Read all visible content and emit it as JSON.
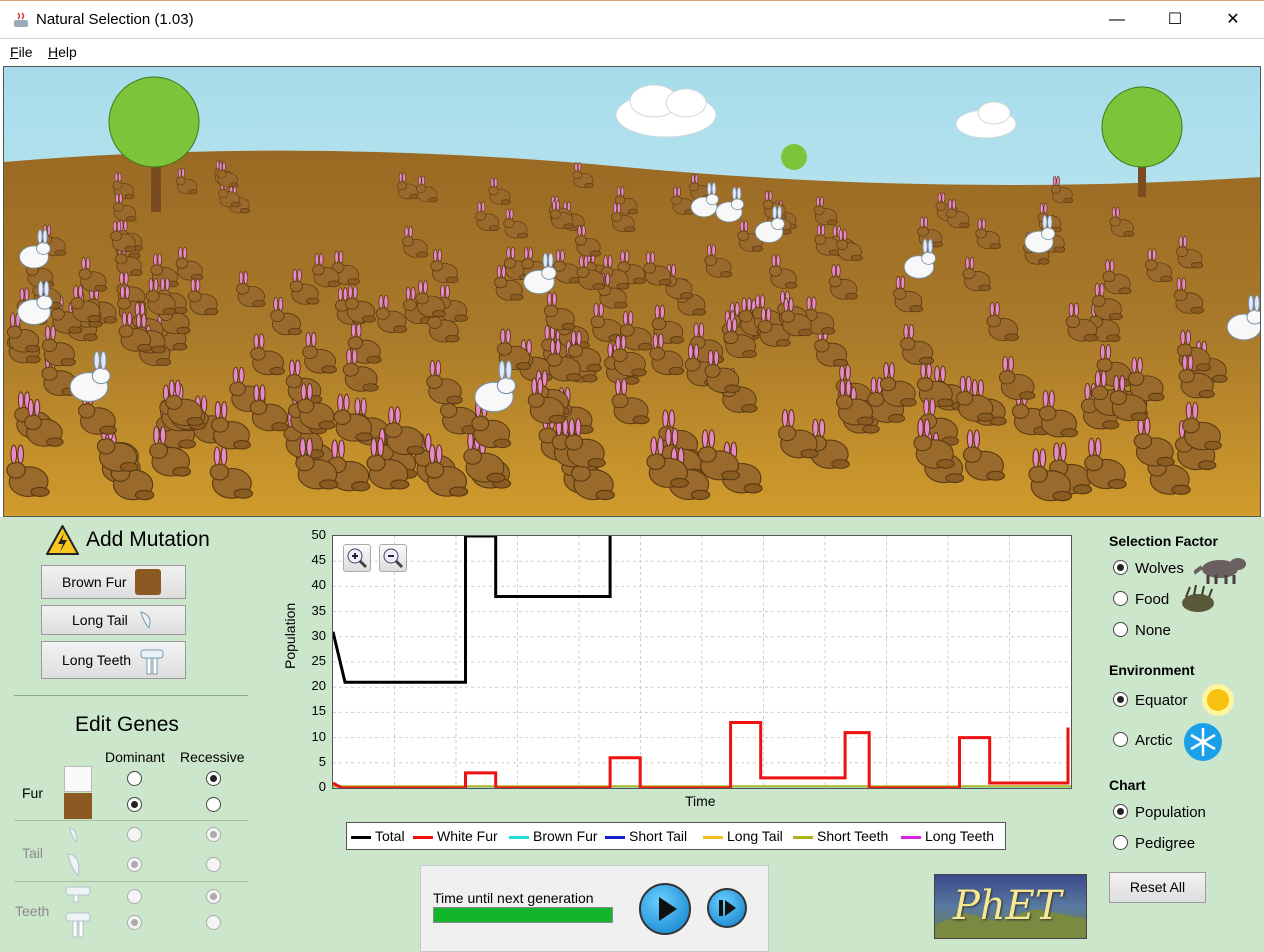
{
  "window": {
    "title": "Natural Selection (1.03)",
    "minimize_glyph": "—",
    "maximize_glyph": "☐",
    "close_glyph": "✕"
  },
  "menu": [
    {
      "key": "F",
      "rest": "ile"
    },
    {
      "key": "H",
      "rest": "elp"
    }
  ],
  "mutation": {
    "title": "Add Mutation",
    "buttons": [
      "Brown Fur",
      "Long Tail",
      "Long Teeth"
    ]
  },
  "genes": {
    "title": "Edit Genes",
    "col_dominant": "Dominant",
    "col_recessive": "Recessive",
    "rows": [
      {
        "label": "Fur",
        "dominant_selected": "bottom",
        "recessive_selected": "top",
        "enabled": true
      },
      {
        "label": "Tail",
        "enabled": false
      },
      {
        "label": "Teeth",
        "enabled": false
      }
    ]
  },
  "chart_data": {
    "type": "line",
    "xlabel": "Time",
    "ylabel": "Population",
    "ylim": [
      0,
      50
    ],
    "yticks": [
      "0",
      "5",
      "10",
      "15",
      "20",
      "25",
      "30",
      "35",
      "40",
      "45",
      "50"
    ],
    "grid": true,
    "series": [
      {
        "name": "Total",
        "color": "#000000"
      },
      {
        "name": "White Fur",
        "color": "#ee1111"
      },
      {
        "name": "Brown Fur",
        "color": "#22dddd"
      },
      {
        "name": "Short Tail",
        "color": "#1122cc"
      },
      {
        "name": "Long Tail",
        "color": "#f0c020"
      },
      {
        "name": "Short Teeth",
        "color": "#b0b020"
      },
      {
        "name": "Long Teeth",
        "color": "#e020e0"
      }
    ],
    "total_steps": [
      [
        0,
        31
      ],
      [
        0.02,
        21
      ],
      [
        0.22,
        21
      ],
      [
        0.22,
        50
      ],
      [
        0.27,
        50
      ],
      [
        0.27,
        38
      ],
      [
        0.46,
        38
      ],
      [
        0.46,
        50
      ]
    ],
    "white_steps": [
      [
        0,
        1
      ],
      [
        0.015,
        0
      ],
      [
        0.22,
        0
      ],
      [
        0.22,
        3
      ],
      [
        0.27,
        3
      ],
      [
        0.27,
        0
      ],
      [
        0.46,
        0
      ],
      [
        0.46,
        6
      ],
      [
        0.51,
        6
      ],
      [
        0.51,
        0
      ],
      [
        0.66,
        0
      ],
      [
        0.66,
        13
      ],
      [
        0.71,
        13
      ],
      [
        0.71,
        2
      ],
      [
        0.85,
        2
      ],
      [
        0.85,
        11
      ],
      [
        0.89,
        11
      ],
      [
        0.89,
        0
      ],
      [
        1.04,
        0
      ],
      [
        1.04,
        10
      ],
      [
        1.09,
        10
      ],
      [
        1.09,
        1
      ],
      [
        1.22,
        1
      ],
      [
        1.22,
        12
      ]
    ],
    "xmax": 1.225
  },
  "time_panel": {
    "label": "Time until next generation",
    "progress": 1.0
  },
  "selection_factor": {
    "title": "Selection Factor",
    "options": [
      "Wolves",
      "Food",
      "None"
    ],
    "selected": 0
  },
  "environment": {
    "title": "Environment",
    "options": [
      "Equator",
      "Arctic"
    ],
    "selected": 0
  },
  "chart_mode": {
    "title": "Chart",
    "options": [
      "Population",
      "Pedigree"
    ],
    "selected": 0
  },
  "reset_label": "Reset All",
  "logo_text": "PhET"
}
